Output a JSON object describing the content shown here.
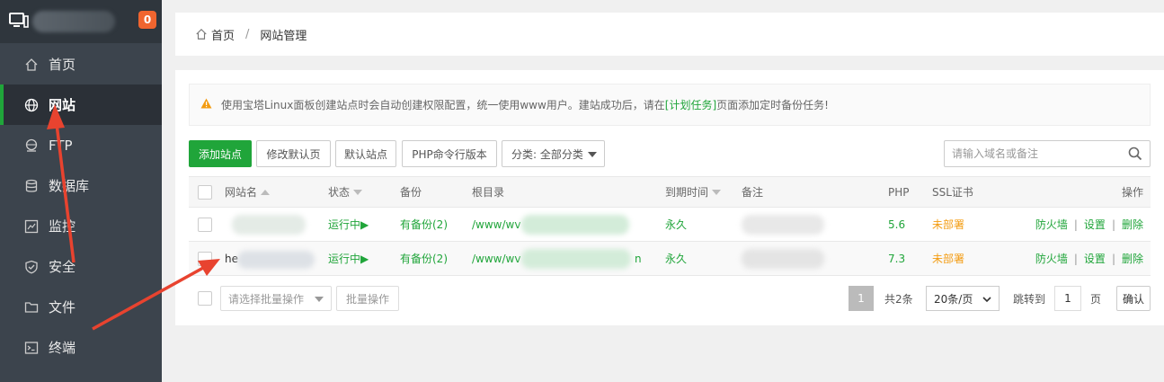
{
  "sidebar": {
    "badge": "0",
    "items": [
      {
        "label": "首页",
        "icon": "home-icon"
      },
      {
        "label": "网站",
        "icon": "globe-icon",
        "active": true
      },
      {
        "label": "FTP",
        "icon": "ftp-globe-icon"
      },
      {
        "label": "数据库",
        "icon": "database-icon"
      },
      {
        "label": "监控",
        "icon": "monitor-chart-icon"
      },
      {
        "label": "安全",
        "icon": "shield-icon"
      },
      {
        "label": "文件",
        "icon": "folder-icon"
      },
      {
        "label": "终端",
        "icon": "terminal-icon"
      }
    ]
  },
  "breadcrumb": {
    "home": "首页",
    "sep": "/",
    "current": "网站管理"
  },
  "notice": {
    "prefix": "使用宝塔Linux面板创建站点时会自动创建权限配置，统一使用www用户。建站成功后，请在",
    "link": "[计划任务]",
    "suffix": "页面添加定时备份任务!"
  },
  "toolbar": {
    "add": "添加站点",
    "default_page": "修改默认页",
    "default_site": "默认站点",
    "php_cli": "PHP命令行版本",
    "category": "分类: 全部分类",
    "search_placeholder": "请输入域名或备注"
  },
  "table": {
    "headers": {
      "name": "网站名",
      "status": "状态",
      "backup": "备份",
      "root": "根目录",
      "expire": "到期时间",
      "note": "备注",
      "php": "PHP",
      "ssl": "SSL证书",
      "ops": "操作"
    },
    "rows": [
      {
        "name": "",
        "status": "运行中▶",
        "backup": "有备份(2)",
        "root": "/www/wv",
        "expire": "永久",
        "php": "5.6",
        "ssl": "未部署"
      },
      {
        "name": "he",
        "status": "运行中▶",
        "backup": "有备份(2)",
        "root": "/www/wv",
        "root_tail": "n",
        "expire": "永久",
        "php": "7.3",
        "ssl": "未部署"
      }
    ],
    "ops": {
      "firewall": "防火墙",
      "settings": "设置",
      "delete": "删除",
      "bar": "|"
    }
  },
  "footer": {
    "batch_placeholder": "请选择批量操作",
    "batch_btn": "批量操作",
    "page": "1",
    "total": "共2条",
    "page_size": "20条/页",
    "goto": "跳转到",
    "goto_value": "1",
    "page_unit": "页",
    "confirm": "确认"
  },
  "colors": {
    "accent": "#20a53a",
    "annotation": "#e8432f",
    "badge": "#f0652f",
    "sidebar": "#3c444d"
  }
}
